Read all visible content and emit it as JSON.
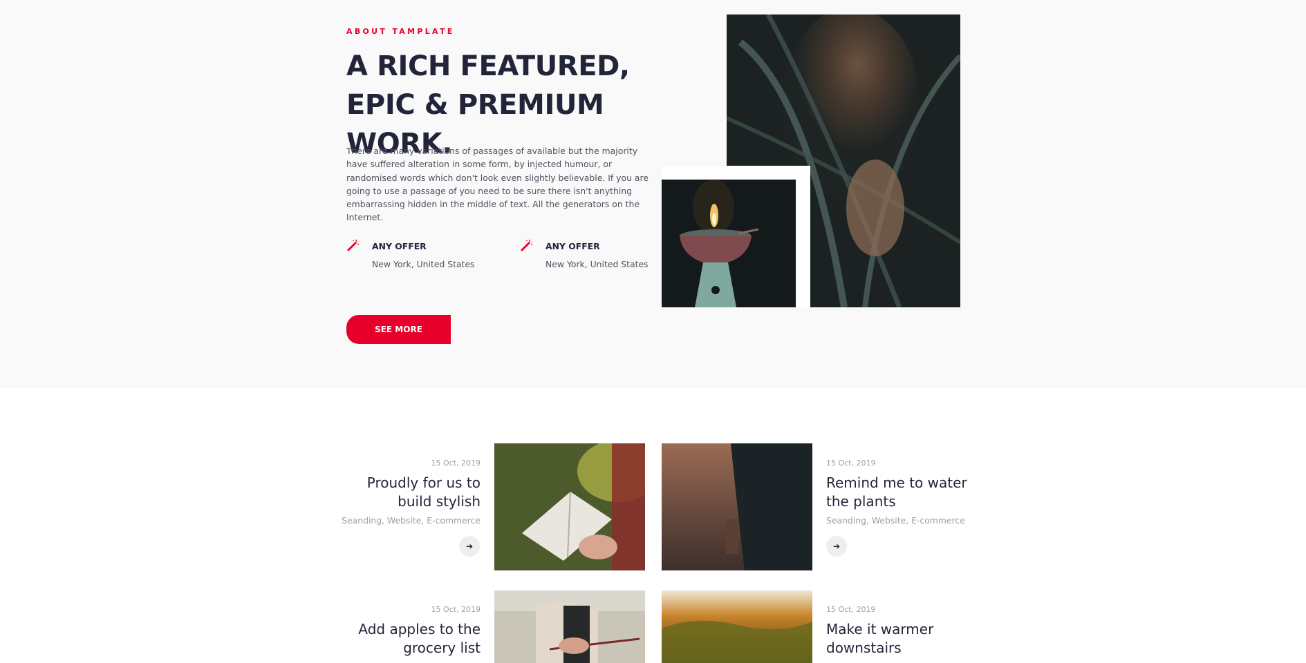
{
  "about": {
    "tag": "ABOUT TAMPLATE",
    "heading": "A RICH FEATURED, EPIC & PREMIUM WORK.",
    "description": "There are many variations of passages of available but the majority have suffered alteration in some form, by injected humour, or randomised words which don't look even slightly believable. If you are going to use a passage of you need to be sure there isn't anything embarrassing hidden in the middle of text. All the generators on the Internet.",
    "features": [
      {
        "icon": "magic-wand-icon",
        "title": "ANY OFFER",
        "subtitle": "New York, United States"
      },
      {
        "icon": "magic-wand-icon",
        "title": "ANY OFFER",
        "subtitle": "New York, United States"
      }
    ],
    "button_label": "SEE MORE"
  },
  "posts": [
    {
      "date": "15 Oct, 2019",
      "title": "Proudly for us to build stylish",
      "categories": "Seanding, Website, E-commerce"
    },
    {
      "date": "15 Oct, 2019",
      "title": "Remind me to water the plants",
      "categories": "Seanding, Website, E-commerce"
    },
    {
      "date": "15 Oct, 2019",
      "title": "Add apples to the grocery list",
      "categories": ""
    },
    {
      "date": "15 Oct, 2019",
      "title": "Make it warmer downstairs",
      "categories": ""
    }
  ],
  "colors": {
    "accent": "#e8002c",
    "heading": "#222539",
    "text": "#50525f",
    "muted": "#9c9da4",
    "section_bg": "#f9f9f9"
  }
}
